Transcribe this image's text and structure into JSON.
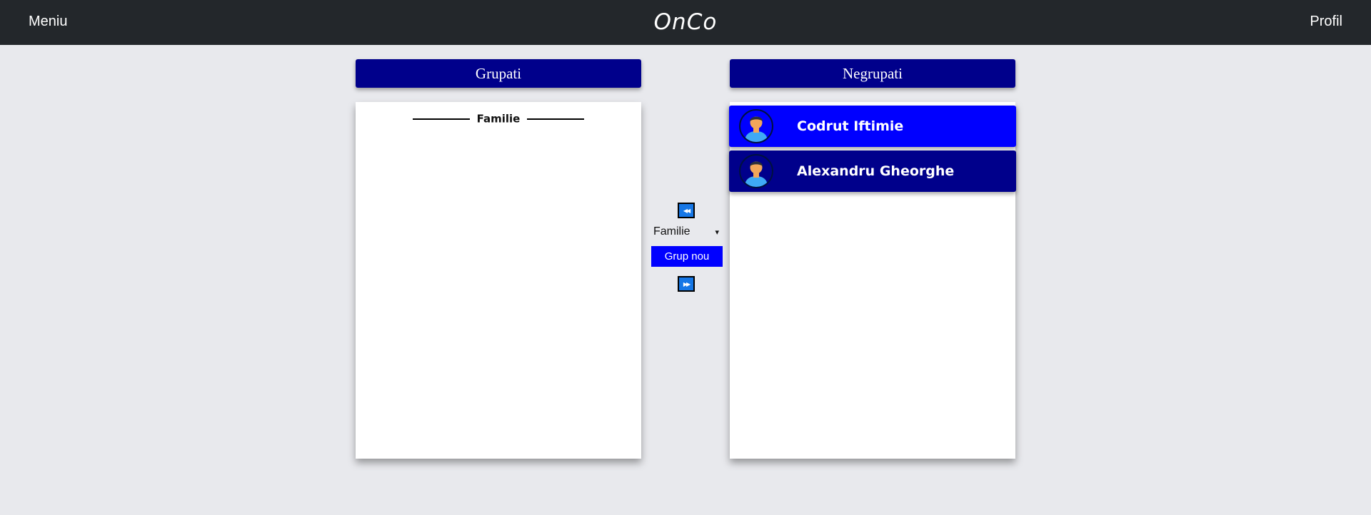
{
  "header": {
    "menu_label": "Meniu",
    "brand": "OnCo",
    "profile_label": "Profil"
  },
  "grouped": {
    "title": "Grupati",
    "groups": [
      {
        "name": "Familie"
      }
    ]
  },
  "ungrouped": {
    "title": "Negrupati",
    "contacts": [
      {
        "name": "Codrut Iftimie",
        "avatar": "person-avatar-icon",
        "selected": true
      },
      {
        "name": "Alexandru Gheorghe",
        "avatar": "person-avatar-icon",
        "selected": false
      }
    ]
  },
  "controls": {
    "move_left_icon": "rewind-icon",
    "move_left_glyph": "◀◀",
    "move_right_icon": "fast-forward-icon",
    "move_right_glyph": "▶▶",
    "group_select_value": "Familie",
    "group_select_arrow": "▾",
    "new_group_label": "Grup nou"
  },
  "colors": {
    "topbar": "#23272b",
    "header_panel": "#00008b",
    "selected_contact": "#0000ff",
    "contact": "#00008b",
    "new_group_button": "#0000ff",
    "move_button": "#1677e6",
    "background": "#e8e9ed"
  }
}
